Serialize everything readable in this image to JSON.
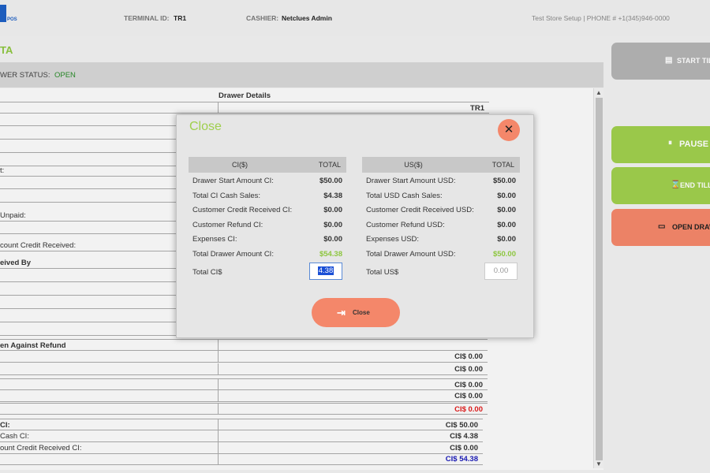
{
  "header": {
    "logo_pos": "POS",
    "terminal_label": "TERMINAL ID:",
    "terminal_value": "TR1",
    "cashier_label": "CASHIER:",
    "cashier_value": "Netclues Admin",
    "store_info": "Test Store Setup | PHONE # +1(345)946-0000"
  },
  "section_title": "TA",
  "status": {
    "label": "WER STATUS:",
    "value": "OPEN"
  },
  "drawer_table": {
    "title": "Drawer Details",
    "terminal": "TR1",
    "rows": [
      {
        "label": "t:"
      },
      {
        "label": "Unpaid:"
      },
      {
        "label": "count Credit Received:"
      },
      {
        "label": "eived By"
      },
      {
        "label": "en Against Refund"
      },
      {
        "value": "CI$ 0.00"
      },
      {
        "value": "CI$ 0.00"
      },
      {
        "value": "CI$ 0.00"
      },
      {
        "value": "CI$ 0.00"
      },
      {
        "value": "CI$ 0.00"
      },
      {
        "label": "CI:",
        "value": "CI$ 50.00"
      },
      {
        "label": "Cash CI:",
        "value": "CI$ 4.38"
      },
      {
        "label": "ount Credit Received CI:",
        "value": "CI$ 0.00"
      },
      {
        "value": "CI$ 54.38"
      }
    ]
  },
  "side_buttons": {
    "start_till": "START TILL",
    "pause": "PAUSE",
    "end_till": "END TILL",
    "open_drawer": "OPEN DRAW"
  },
  "modal": {
    "title": "Close",
    "close_label": "Close",
    "ci": {
      "header": "CI($)",
      "total_header": "TOTAL",
      "rows": [
        {
          "label": "Drawer Start Amount CI:",
          "value": "$50.00"
        },
        {
          "label": "Total CI Cash Sales:",
          "value": "$4.38"
        },
        {
          "label": "Customer Credit Received CI:",
          "value": "$0.00"
        },
        {
          "label": "Customer Refund CI:",
          "value": "$0.00"
        },
        {
          "label": "Expenses CI:",
          "value": "$0.00"
        },
        {
          "label": "Total Drawer Amount CI:",
          "value": "$54.38"
        }
      ],
      "total_label": "Total CI$",
      "total_input": "4.38"
    },
    "usd": {
      "header": "US($)",
      "total_header": "TOTAL",
      "rows": [
        {
          "label": "Drawer Start Amount USD:",
          "value": "$50.00"
        },
        {
          "label": "Total USD Cash Sales:",
          "value": "$0.00"
        },
        {
          "label": "Customer Credit Received USD:",
          "value": "$0.00"
        },
        {
          "label": "Customer Refund USD:",
          "value": "$0.00"
        },
        {
          "label": "Expenses USD:",
          "value": "$0.00"
        },
        {
          "label": "Total Drawer Amount USD:",
          "value": "$50.00"
        }
      ],
      "total_label": "Total US$",
      "total_input_placeholder": "0.00"
    }
  },
  "colors": {
    "accent_green": "#9fcf4d",
    "accent_salmon": "#f4876a",
    "status_green": "#2a8c2a",
    "brand_blue": "#1d5fc4"
  }
}
